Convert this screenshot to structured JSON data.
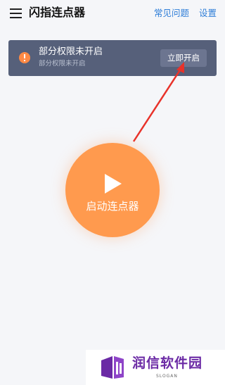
{
  "header": {
    "title": "闪指连点器",
    "faq_label": "常见问题",
    "settings_label": "设置",
    "menu_icon": "hamburger-menu-icon"
  },
  "banner": {
    "title": "部分权限未开启",
    "subtitle": "部分权限未开启",
    "button_label": "立即开启",
    "icon": "warning-icon",
    "colors": {
      "background": "#56607a",
      "button": "#6c7590",
      "icon": "#ff8a45"
    }
  },
  "main": {
    "start_label": "启动连点器",
    "start_icon": "play-icon",
    "accent_color": "#ff9a4e"
  },
  "watermark": {
    "text": "润信软件园",
    "slogan": "SLOGAN",
    "color": "#6b2aa5"
  }
}
